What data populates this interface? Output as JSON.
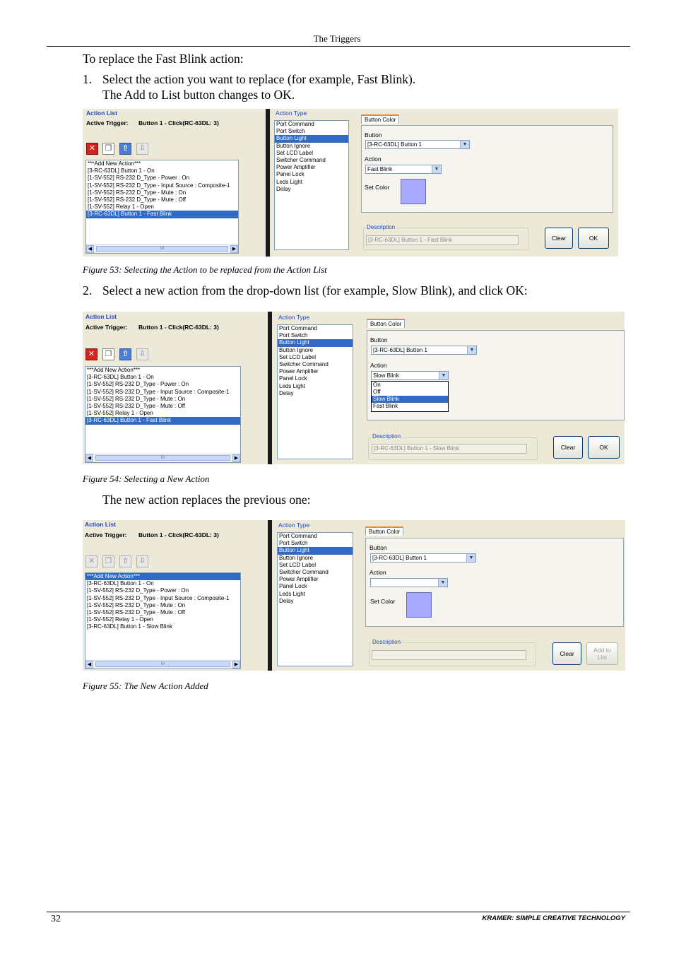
{
  "header": {
    "title": "The Triggers"
  },
  "intro": "To replace the Fast Blink action:",
  "steps": [
    {
      "num": "1.",
      "text": "Select the action you want to replace (for example, Fast Blink).",
      "text2": "The Add to List button changes to OK."
    },
    {
      "num": "2.",
      "text": "Select a new action from the drop-down list (for example, Slow Blink), and click OK:"
    }
  ],
  "after_text": "The new action replaces the previous one:",
  "common": {
    "action_list_title": "Action List",
    "active_trigger_label": "Active Trigger:",
    "active_trigger_value": "Button 1 - Click(RC-63DL: 3)",
    "action_type_title": "Action Type",
    "action_types": [
      "Port Command",
      "Port Switch",
      "Button Light",
      "Button Ignore",
      "Set LCD Label",
      "Switcher Command",
      "Power Amplifier",
      "Panel Lock",
      "Leds Light",
      "Delay"
    ],
    "tab_label": "Button Color",
    "button_label": "Button",
    "button_value": "[3-RC-63DL] Button 1",
    "action_label": "Action",
    "set_color_label": "Set Color",
    "description_label": "Description",
    "clear_label": "Clear",
    "scroll_thumb": "III"
  },
  "figures": [
    {
      "caption": "Figure 53: Selecting the Action to be replaced from the Action List",
      "list_items": [
        "***Add New Action***",
        "[3-RC-63DL] Button 1 - On",
        "[1-SV-552] RS-232 D_Type - Power : On",
        "[1-SV-552] RS-232 D_Type - Input Source : Composite-1",
        "[1-SV-552] RS-232 D_Type - Mute : On",
        "[1-SV-552] RS-232 D_Type - Mute : Off",
        "[1-SV-552] Relay 1 - Open",
        "[3-RC-63DL] Button 1 - Fast Blink"
      ],
      "action_value": "Fast Blink",
      "description_value": "[3-RC-63DL] Button 1 - Fast Blink",
      "right_button": "OK"
    },
    {
      "caption": "Figure 54: Selecting a New Action",
      "list_items": [
        "***Add New Action***",
        "[3-RC-63DL] Button 1 - On",
        "[1-SV-552] RS-232 D_Type - Power : On",
        "[1-SV-552] RS-232 D_Type - Input Source : Composite-1",
        "[1-SV-552] RS-232 D_Type - Mute : On",
        "[1-SV-552] RS-232 D_Type - Mute : Off",
        "[1-SV-552] Relay 1 - Open",
        "[3-RC-63DL] Button 1 - Fast Blink"
      ],
      "action_value": "Slow Blink",
      "dropdown_options": [
        "On",
        "Off",
        "Slow Blink",
        "Fast Blink"
      ],
      "description_value": "[3-RC-63DL] Button 1 - Slow Blink",
      "right_button": "OK"
    },
    {
      "caption": "Figure 55: The New Action Added",
      "list_items": [
        "***Add New Action***",
        "[3-RC-63DL] Button 1 - On",
        "[1-SV-552] RS-232 D_Type - Power : On",
        "[1-SV-552] RS-232 D_Type - Input Source : Composite-1",
        "[1-SV-552] RS-232 D_Type - Mute : On",
        "[1-SV-552] RS-232 D_Type - Mute : Off",
        "[1-SV-552] Relay 1 - Open",
        "[3-RC-63DL] Button 1 - Slow Blink"
      ],
      "action_value": "",
      "description_value": "",
      "right_button_line1": "Add to",
      "right_button_line2": "List"
    }
  ],
  "footer": {
    "page_number": "32",
    "brand": "KRAMER:  SIMPLE CREATIVE TECHNOLOGY"
  }
}
